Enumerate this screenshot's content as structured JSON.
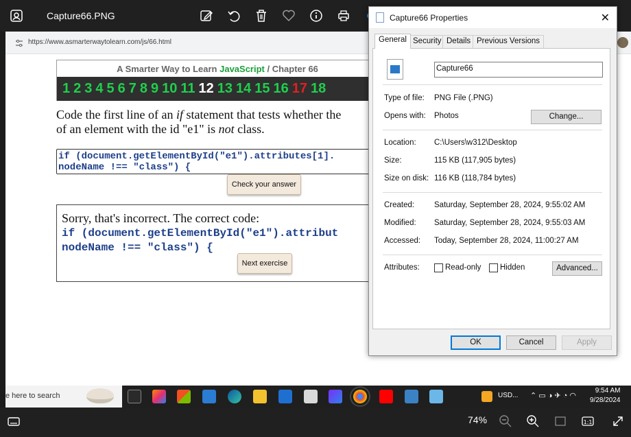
{
  "viewer": {
    "file_title": "Capture66.PNG",
    "zoom": "74%",
    "toolbar_icons": [
      "edit-icon",
      "rotate-icon",
      "delete-icon",
      "heart-icon",
      "info-icon",
      "print-icon"
    ]
  },
  "browser": {
    "url": "https://www.asmarterwaytolearn.com/js/66.html"
  },
  "page": {
    "header_prefix": "A Smarter Way to Learn",
    "header_js": "JavaScript",
    "header_suffix": "/  Chapter 66",
    "numbers": [
      "1",
      "2",
      "3",
      "4",
      "5",
      "6",
      "7",
      "8",
      "9",
      "10",
      "11",
      "12",
      "13",
      "14",
      "15",
      "16",
      "17",
      "18"
    ],
    "current_number": "12",
    "red_number": "17",
    "question_parts": {
      "a": "Code the first line of an ",
      "if": "if",
      "b": " statement that tests whether the",
      "c": "of an element with the id \"e1\" is ",
      "not": "not",
      "d": " class."
    },
    "code_input_line1": "if (document.getElementById(\"e1\").attributes[1].",
    "code_input_line2": "nodeName !== \"class\") {",
    "check_button": "Check your answer",
    "sorry_text": "Sorry, that's incorrect. The correct code:",
    "correct_line1": "if (document.getElementById(\"e1\").attribut",
    "correct_line2": "nodeName !== \"class\") {",
    "next_button": "Next exercise"
  },
  "taskbar": {
    "search_text": "e here to search",
    "tray_currency": "USD...",
    "time": "9:54 AM",
    "date": "9/28/2024"
  },
  "dialog": {
    "title": "Capture66 Properties",
    "tabs": [
      "General",
      "Security",
      "Details",
      "Previous Versions"
    ],
    "filename": "Capture66",
    "type_label": "Type of file:",
    "type_value": "PNG File (.PNG)",
    "opens_label": "Opens with:",
    "opens_value": "Photos",
    "change_button": "Change...",
    "location_label": "Location:",
    "location_value": "C:\\Users\\w312\\Desktop",
    "size_label": "Size:",
    "size_value": "115 KB (117,905 bytes)",
    "sizeondisk_label": "Size on disk:",
    "sizeondisk_value": "116 KB (118,784 bytes)",
    "created_label": "Created:",
    "created_value": "Saturday, September 28, 2024, 9:55:02 AM",
    "modified_label": "Modified:",
    "modified_value": "Saturday, September 28, 2024, 9:55:03 AM",
    "accessed_label": "Accessed:",
    "accessed_value": "Today, September 28, 2024, 11:00:27 AM",
    "attributes_label": "Attributes:",
    "readonly_label": "Read-only",
    "hidden_label": "Hidden",
    "advanced_button": "Advanced...",
    "ok_button": "OK",
    "cancel_button": "Cancel",
    "apply_button": "Apply"
  },
  "colors": {
    "accent": "#0078d7",
    "js_green": "#1a9e3a",
    "number_green": "#1fcf4d",
    "number_red": "#e02121",
    "code_blue": "#1d3f8a"
  }
}
